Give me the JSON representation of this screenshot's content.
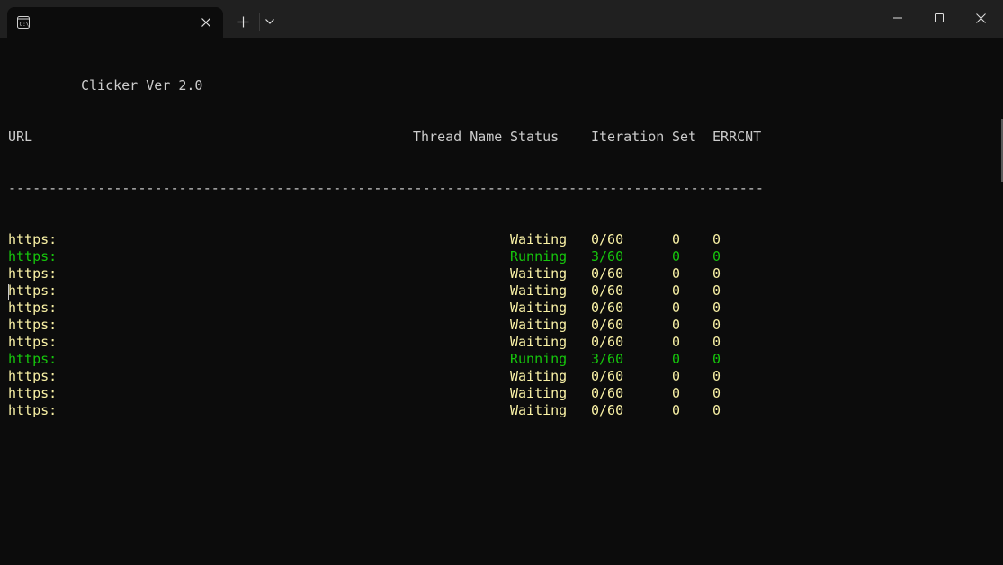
{
  "window": {
    "tab_icon": "terminal-icon",
    "controls": [
      "minimize-icon",
      "maximize-icon",
      "close-icon"
    ]
  },
  "terminal": {
    "title": "Clicker Ver 2.0",
    "headers": {
      "url": "URL",
      "thread_name": "Thread Name",
      "status": "Status",
      "iteration": "Iteration",
      "set": "Set",
      "errcnt": "ERRCNT"
    },
    "separator": "---------------------------------------------------------------------------------------------",
    "rows": [
      {
        "url": "https:",
        "status": "Waiting",
        "iteration": "0/60",
        "set": "0",
        "errcnt": "0",
        "color": "#f9f1a5"
      },
      {
        "url": "https:",
        "status": "Running",
        "iteration": "3/60",
        "set": "0",
        "errcnt": "0",
        "color": "#16c60c"
      },
      {
        "url": "https:",
        "status": "Waiting",
        "iteration": "0/60",
        "set": "0",
        "errcnt": "0",
        "color": "#f9f1a5"
      },
      {
        "url": "https:",
        "status": "Waiting",
        "iteration": "0/60",
        "set": "0",
        "errcnt": "0",
        "color": "#f9f1a5"
      },
      {
        "url": "https:",
        "status": "Waiting",
        "iteration": "0/60",
        "set": "0",
        "errcnt": "0",
        "color": "#f9f1a5"
      },
      {
        "url": "https:",
        "status": "Waiting",
        "iteration": "0/60",
        "set": "0",
        "errcnt": "0",
        "color": "#f9f1a5"
      },
      {
        "url": "https:",
        "status": "Waiting",
        "iteration": "0/60",
        "set": "0",
        "errcnt": "0",
        "color": "#f9f1a5"
      },
      {
        "url": "https:",
        "status": "Running",
        "iteration": "3/60",
        "set": "0",
        "errcnt": "0",
        "color": "#16c60c"
      },
      {
        "url": "https:",
        "status": "Waiting",
        "iteration": "0/60",
        "set": "0",
        "errcnt": "0",
        "color": "#f9f1a5"
      },
      {
        "url": "https:",
        "status": "Waiting",
        "iteration": "0/60",
        "set": "0",
        "errcnt": "0",
        "color": "#f9f1a5"
      },
      {
        "url": "https:",
        "status": "Waiting",
        "iteration": "0/60",
        "set": "0",
        "errcnt": "0",
        "color": "#f9f1a5"
      }
    ]
  }
}
